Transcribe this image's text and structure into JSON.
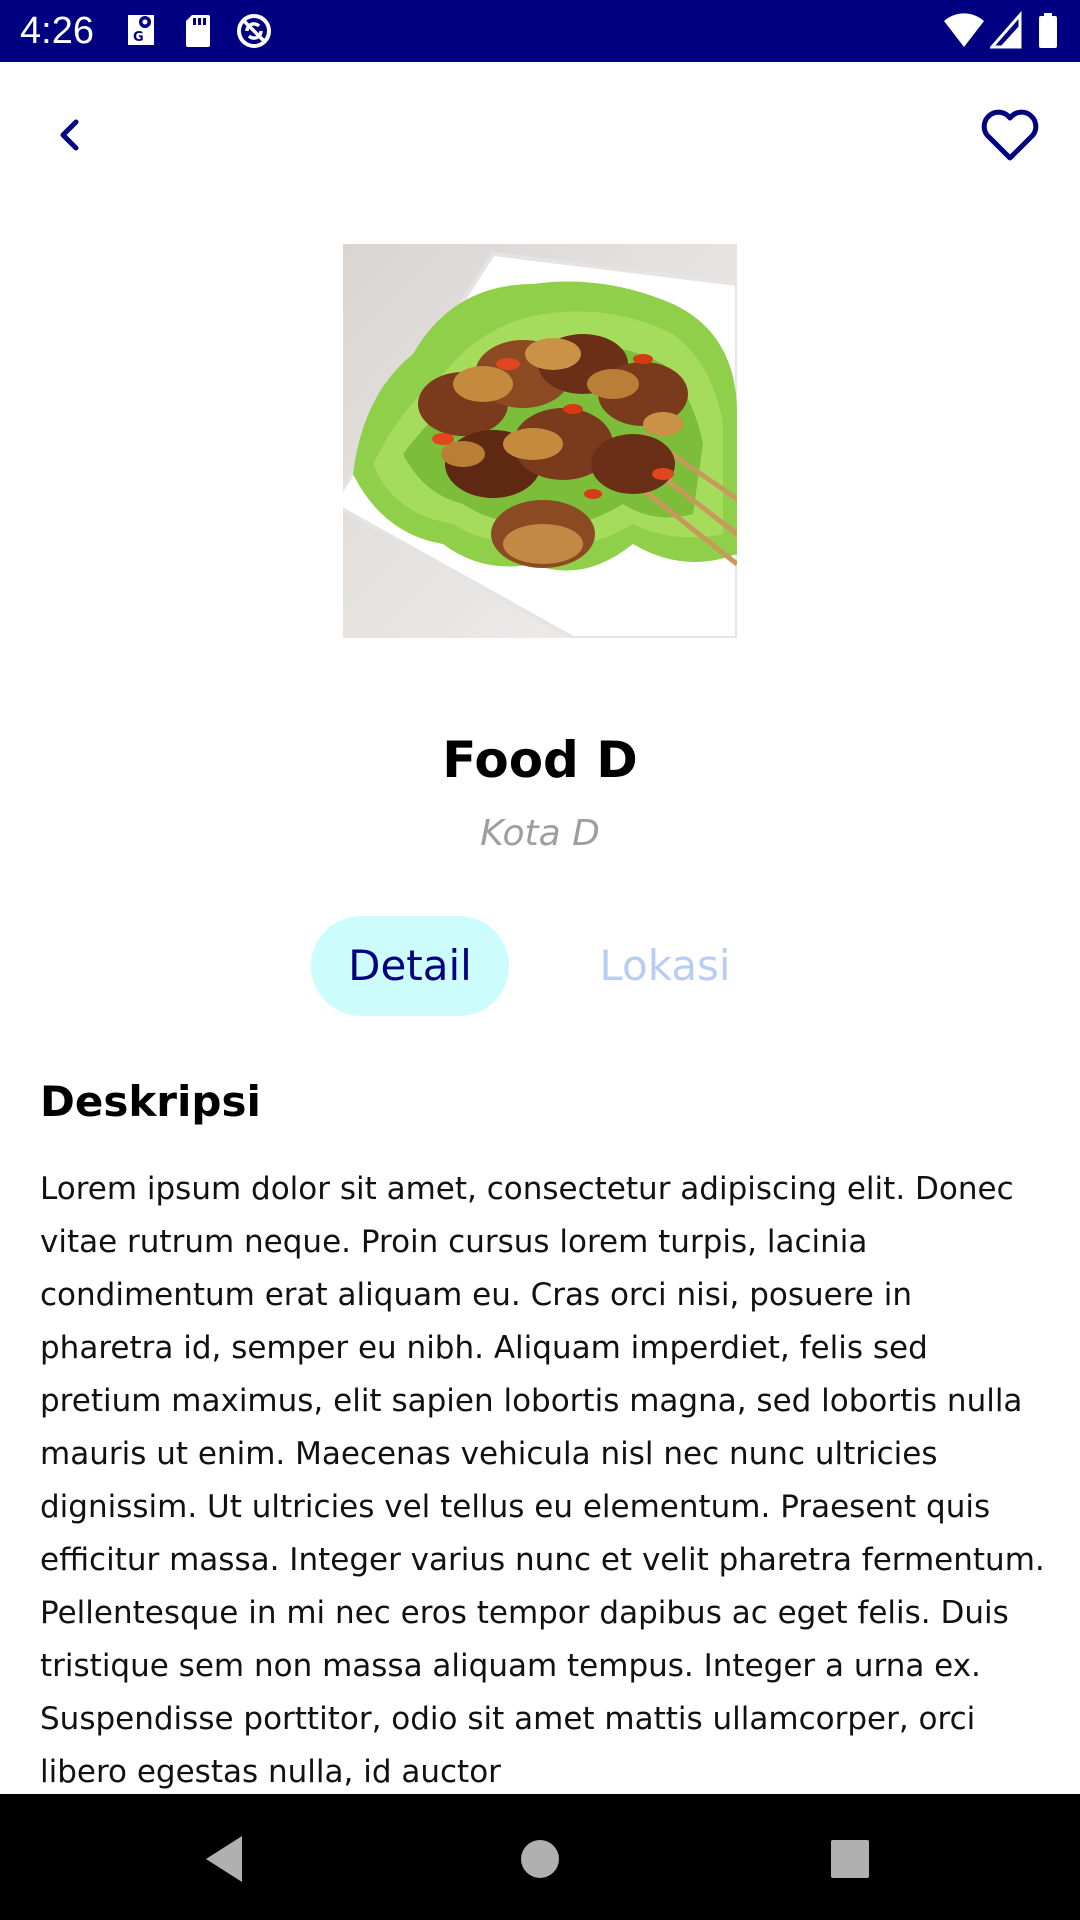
{
  "status_bar": {
    "time": "4:26",
    "left_icons": [
      "maps-notification-icon",
      "sd-card-icon",
      "sync-disabled-icon"
    ],
    "right_icons": [
      "wifi-icon",
      "cell-signal-icon",
      "battery-icon"
    ],
    "background_color": "#000080"
  },
  "app_bar": {
    "back_icon": "chevron-left-icon",
    "favorite_icon": "heart-outline-icon",
    "icon_color": "#000080"
  },
  "food": {
    "image": "satay-skewers-with-peanut-sauce",
    "title": "Food D",
    "city": "Kota D"
  },
  "tabs": [
    {
      "label": "Detail",
      "selected": true
    },
    {
      "label": "Lokasi",
      "selected": false
    }
  ],
  "description": {
    "heading": "Deskripsi",
    "text": "Lorem ipsum dolor sit amet, consectetur adipiscing elit. Donec vitae rutrum neque. Proin cursus lorem turpis, lacinia condimentum erat aliquam eu. Cras orci nisi, posuere in pharetra id, semper eu nibh. Aliquam imperdiet, felis sed pretium maximus, elit sapien lobortis magna, sed lobortis nulla mauris ut enim. Maecenas vehicula nisl nec nunc ultricies dignissim. Ut ultricies vel tellus eu elementum. Praesent quis efficitur massa. Integer varius nunc et velit pharetra fermentum. Pellentesque in mi nec eros tempor dapibus ac eget felis. Duis tristique sem non massa aliquam tempus. Integer a urna ex. Suspendisse porttitor, odio sit amet mattis ullamcorper, orci libero egestas nulla, id auctor"
  },
  "nav_bar": {
    "buttons": [
      "back-triangle-icon",
      "home-circle-icon",
      "recents-square-icon"
    ]
  },
  "colors": {
    "primary": "#000080",
    "tab_selected_bg": "#ccfcfc",
    "tab_unselected_text": "#b9cdf4",
    "subtitle": "#9e9e9e"
  }
}
